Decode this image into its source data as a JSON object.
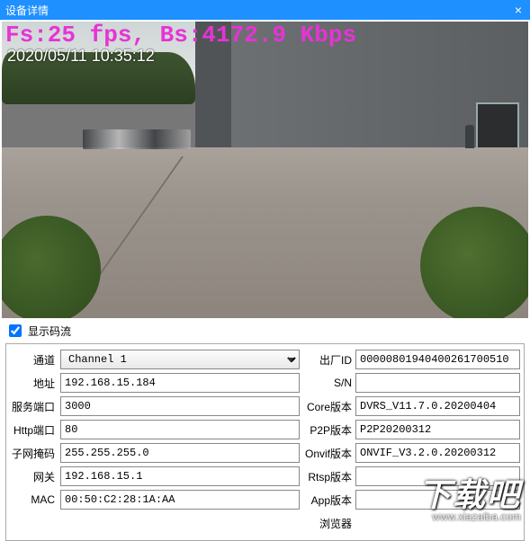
{
  "window": {
    "title": "设备详情",
    "close_icon_label": "×"
  },
  "video": {
    "overlay_fps": "Fs:25 fps,  Bs:4172.9 Kbps",
    "overlay_timestamp": "2020/05/11 10:35:12"
  },
  "options": {
    "show_stream_label": "显示码流",
    "show_stream_checked": true
  },
  "left": {
    "channel": {
      "label": "通道",
      "value": "Channel 1"
    },
    "address": {
      "label": "地址",
      "value": "192.168.15.184"
    },
    "service_port": {
      "label": "服务端口",
      "value": "3000"
    },
    "http_port": {
      "label": "Http端口",
      "value": "80"
    },
    "subnet": {
      "label": "子网掩码",
      "value": "255.255.255.0"
    },
    "gateway": {
      "label": "网关",
      "value": "192.168.15.1"
    },
    "mac": {
      "label": "MAC",
      "value": "00:50:C2:28:1A:AA"
    }
  },
  "right": {
    "factory_id": {
      "label": "出厂ID",
      "value": "00000801940400261700510"
    },
    "sn": {
      "label": "S/N",
      "value": ""
    },
    "core_ver": {
      "label": "Core版本",
      "value": "DVRS_V11.7.0.20200404"
    },
    "p2p_ver": {
      "label": "P2P版本",
      "value": "P2P20200312"
    },
    "onvif_ver": {
      "label": "Onvif版本",
      "value": "ONVIF_V3.2.0.20200312"
    },
    "rtsp_ver": {
      "label": "Rtsp版本",
      "value": ""
    },
    "app_ver": {
      "label": "App版本",
      "value": ""
    },
    "browser": {
      "label": "浏览器",
      "value": ""
    }
  },
  "watermark": {
    "line1": "下载吧",
    "line2": "www.xiazaiba.com"
  }
}
